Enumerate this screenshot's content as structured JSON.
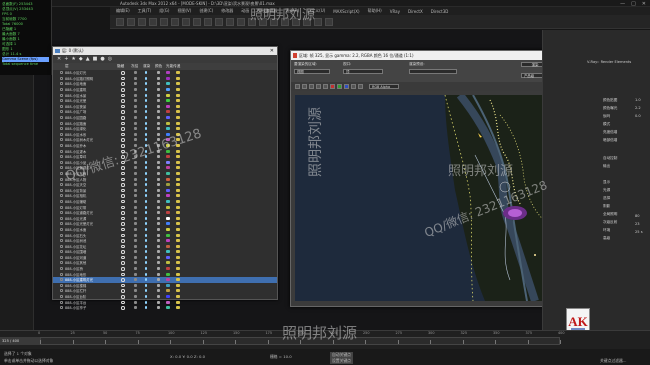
{
  "app": {
    "title": "Autodesk 3ds Max 2012 x64 - [MODE-SKIN] - D:\\3D\\渲染\\滨水景观\\夜景\\01.max",
    "window_controls": [
      "—",
      "□",
      "✕"
    ]
  },
  "menubar": [
    "编辑(E)",
    "工具(T)",
    "组(G)",
    "视图(V)",
    "创建(C)",
    "修改器",
    "动画",
    "图形编辑器",
    "渲染(R)",
    "自定义(U)",
    "MAXScript(X)",
    "帮助(H)",
    "VRay",
    "DirectX",
    "Direct3D"
  ],
  "stats": {
    "lines": [
      "总面数(F) 253443",
      "总顶点(V) 253443",
      "FPS 0",
      "当前帧数 7700",
      "Total 76000",
      "已隐藏 1",
      "最大面数 7",
      "最小面数 1",
      "可选择 1",
      "图形 1",
      "总计 11.4 s"
    ],
    "highlight": "Gamma Scene (fps)",
    "last": "Total sequence time"
  },
  "layer_window": {
    "title": "层: 0 (默认)",
    "columns": [
      "层",
      "隐藏",
      "冻结",
      "渲染",
      "颜色",
      "光能传递"
    ],
    "close": "✕",
    "toolbar_icons": [
      "✕",
      "+",
      "★",
      "◆",
      "▲",
      "■",
      "●",
      "◎"
    ],
    "rows": [
      {
        "name": "888-小区灯光",
        "color": "#b040c0"
      },
      {
        "name": "888-小区路灯照明",
        "color": "#a030c0"
      },
      {
        "name": "888-小区地面",
        "color": "#40c0c0"
      },
      {
        "name": "888-小区建筑",
        "color": "#50a0ff"
      },
      {
        "name": "888-小区水景",
        "color": "#d0d040"
      },
      {
        "name": "888-小区光晕",
        "color": "#40d040"
      },
      {
        "name": "888-小区夜景",
        "color": "#c040c0"
      },
      {
        "name": "888-小区广场",
        "color": "#c04040"
      },
      {
        "name": "888-小区园路",
        "color": "#6060ff"
      },
      {
        "name": "888-小区路面",
        "color": "#c0c040"
      },
      {
        "name": "888-小区绿化",
        "color": "#40c0c0"
      },
      {
        "name": "888-小区水系",
        "color": "#4080ff"
      },
      {
        "name": "888-小区树木灯光",
        "color": "#c060c0"
      },
      {
        "name": "888-小区乔木",
        "color": "#d0d040"
      },
      {
        "name": "888-小区灌木",
        "color": "#40c040"
      },
      {
        "name": "888-小区草坪",
        "color": "#c04040"
      },
      {
        "name": "888-小区小品",
        "color": "#8080ff"
      },
      {
        "name": "888-小区景观灯",
        "color": "#c040a0"
      },
      {
        "name": "888-小区车辆",
        "color": "#40c0a0"
      },
      {
        "name": "888-小区人物",
        "color": "#d06040"
      },
      {
        "name": "888-小区天空",
        "color": "#a0a040"
      },
      {
        "name": "888-小区背景",
        "color": "#6060ff"
      },
      {
        "name": "888-小区相机",
        "color": "#c040c0"
      },
      {
        "name": "888-小区辅助",
        "color": "#40c0c0"
      },
      {
        "name": "888-小区灯带",
        "color": "#c0c040"
      },
      {
        "name": "888-小区道路灯光",
        "color": "#c04040"
      },
      {
        "name": "888-小区光源",
        "color": "#ffffff"
      },
      {
        "name": "888-小区光晕灯光",
        "color": "#4080ff"
      },
      {
        "name": "888-小区水面",
        "color": "#d0d040"
      },
      {
        "name": "888-小区石头",
        "color": "#40c040"
      },
      {
        "name": "888-小区树池",
        "color": "#c040c0"
      },
      {
        "name": "888-小区花坛",
        "color": "#c06040"
      },
      {
        "name": "888-小区围墙",
        "color": "#40c0c0"
      },
      {
        "name": "888-小区河道",
        "color": "#6060ff"
      },
      {
        "name": "888-小区其他",
        "color": "#c0c040"
      },
      {
        "name": "888-小区桥",
        "color": "#c04040"
      },
      {
        "name": "888-小区地形",
        "color": "#40c040"
      },
      {
        "name": "888-小区建筑灯光",
        "color": "#c040a0"
      },
      {
        "name": "888-小区楼梯",
        "color": "#40a0c0"
      },
      {
        "name": "888-小区栏杆",
        "color": "#c0a040"
      },
      {
        "name": "888-小区台阶",
        "color": "#4040ff"
      },
      {
        "name": "888-小区平台",
        "color": "#c060c0"
      },
      {
        "name": "888-小区亭子",
        "color": "#40c0a0"
      }
    ],
    "selected_index": 37
  },
  "render_window": {
    "title": "区域: 帧 325, 显示 gamma: 2.2, RGBA 颜色 16 位/通道 (1:1)",
    "labels": {
      "area_to_render": "要渲染的区域:",
      "viewport": "视口:",
      "render_preset": "渲染预设:",
      "render_btn": "渲染",
      "production": "产品级",
      "area_val": "视图",
      "viewport_val": "顶",
      "channel_val": "RGB Alpha"
    }
  },
  "right_panel": {
    "title": "V-Ray:: Render Elements",
    "labels": [
      "颜色贴图",
      "颜色曝光",
      "伽玛",
      "模式",
      "亮度倍增",
      "暗部倍增",
      "自动控制",
      "输出",
      "显示",
      "光源",
      "选择",
      "阴影",
      "全局照明",
      "次级反射",
      "环境",
      "高级",
      "1.0",
      "2.2",
      "0.0",
      "80",
      "23",
      "25 s"
    ]
  },
  "timeline": {
    "current": "325 / 400",
    "ticks": [
      "0",
      "25",
      "50",
      "75",
      "100",
      "125",
      "150",
      "175",
      "200",
      "225",
      "250",
      "275",
      "300",
      "325",
      "350",
      "375",
      "400"
    ]
  },
  "status": {
    "left": "选择了 1 个对象",
    "prompt": "单击或单击并拖动以选择对象",
    "coords": "X: 0.0   Y: 0.0   Z: 0.0",
    "grid": "栅格 = 10.0",
    "auto_key": "自动关键点",
    "set_key": "设置关键点",
    "filters": "关键点过滤器..."
  },
  "watermarks": [
    "照明邦刘源",
    "QQ/微信: 2321163128",
    "照明邦刘源",
    "QQ/微信: 2321163128",
    "照明邦刘源",
    "照明邦刘源"
  ],
  "logo": "AK"
}
